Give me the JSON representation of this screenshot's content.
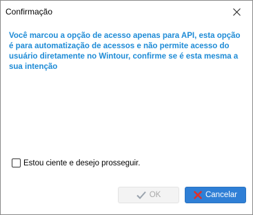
{
  "window": {
    "title": "Confirmação"
  },
  "message": {
    "text": "Você marcou a opção de acesso apenas para API, esta opção é para automatização de acessos e não permite acesso do usuário diretamente no Wintour, confirme se é esta mesma a sua intenção",
    "color": "#1e8bd6"
  },
  "checkbox": {
    "label": "Estou ciente e desejo prosseguir.",
    "checked": false
  },
  "buttons": {
    "ok_label": "OK",
    "ok_enabled": false,
    "ok_icon": "checkmark-icon",
    "cancel_label": "Cancelar",
    "cancel_icon": "red-x-icon",
    "cancel_color": "#2f7fd6"
  }
}
